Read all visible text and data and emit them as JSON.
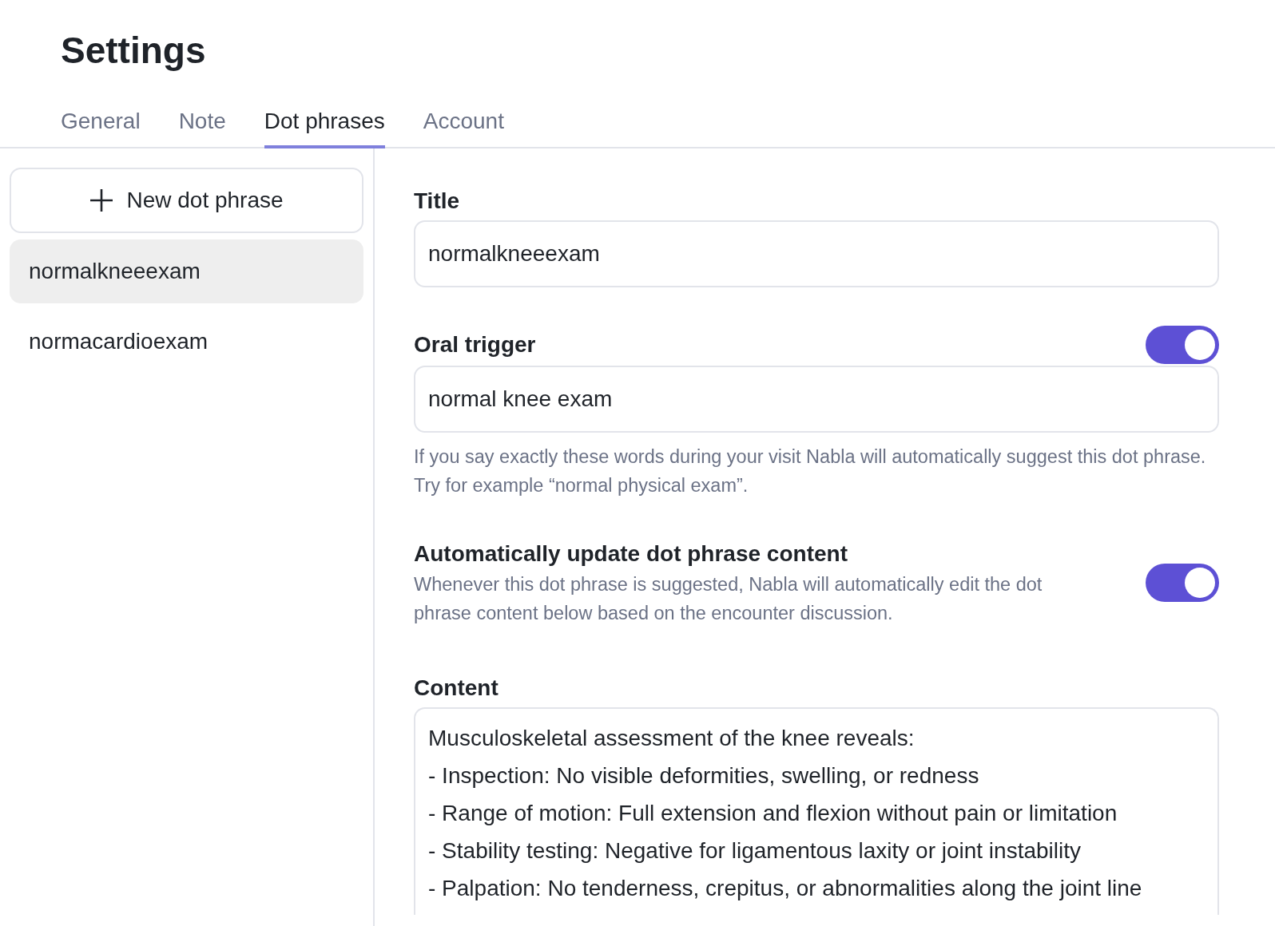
{
  "title": "Settings",
  "tabs": [
    {
      "label": "General",
      "selected": false
    },
    {
      "label": "Note",
      "selected": false
    },
    {
      "label": "Dot phrases",
      "selected": true
    },
    {
      "label": "Account",
      "selected": false
    }
  ],
  "sidebar": {
    "new_button": "New dot phrase",
    "items": [
      {
        "label": "normalkneeexam",
        "selected": true
      },
      {
        "label": "normacardioexam",
        "selected": false
      }
    ]
  },
  "form": {
    "title_field": {
      "label": "Title",
      "value": "normalkneeexam"
    },
    "oral_trigger": {
      "label": "Oral trigger",
      "on": true,
      "value": "normal knee exam",
      "help": "If you say exactly these words during your visit Nabla will automatically suggest this dot phrase. Try for example “normal physical exam”."
    },
    "auto_update": {
      "label": "Automatically update dot phrase content",
      "description": "Whenever this dot phrase is suggested, Nabla will automatically edit the dot phrase content below based on the encounter discussion.",
      "on": true
    },
    "content": {
      "label": "Content",
      "lines": [
        "Musculoskeletal assessment of the knee reveals:",
        "- Inspection: No visible deformities, swelling, or redness",
        "- Range of motion: Full extension and flexion without pain or limitation",
        "- Stability testing: Negative for ligamentous laxity or joint instability",
        "- Palpation: No tenderness, crepitus, or abnormalities along the joint line"
      ]
    }
  }
}
